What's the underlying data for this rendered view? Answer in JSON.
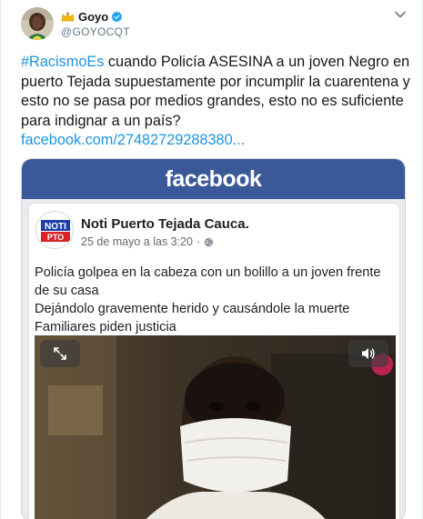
{
  "tweet": {
    "author_name": "Goyo",
    "author_handle": "@GOYOCQT",
    "text": {
      "hashtag": "#RacismoEs",
      "body": " cuando Policía ASESINA a un joven Negro en puerto Tejada supuestamente por incumplir la cuarentena y esto no se pasa por medios grandes, esto no es suficiente para indignar a un país?",
      "link": "facebook.com/27482729288380..."
    },
    "icons": {
      "avatar": "profile-photo",
      "crown": "crown-emoji",
      "verified": "verified-badge",
      "more": "chevron-down-icon"
    },
    "colors": {
      "link": "#1b95e0",
      "verified": "#1da1f2",
      "text": "#14171a",
      "muted": "#657786"
    }
  },
  "card": {
    "brand": "facebook",
    "brand_color": "#3b5998",
    "post": {
      "page_name": "Noti Puerto Tejada Cauca.",
      "page_logo_top": "NOTI",
      "page_logo_bottom": "PTO",
      "date": "25 de mayo a las 3:20",
      "separator": "·",
      "privacy_icon": "globe-icon",
      "text_lines": [
        "Policía golpea en la cabeza con un bolillo a un joven frente de su casa",
        "Dejándolo gravemente herido y causándole la muerte",
        "Familiares piden justicia"
      ]
    },
    "video": {
      "expand_icon": "expand-icon",
      "volume_icon": "volume-icon"
    }
  }
}
